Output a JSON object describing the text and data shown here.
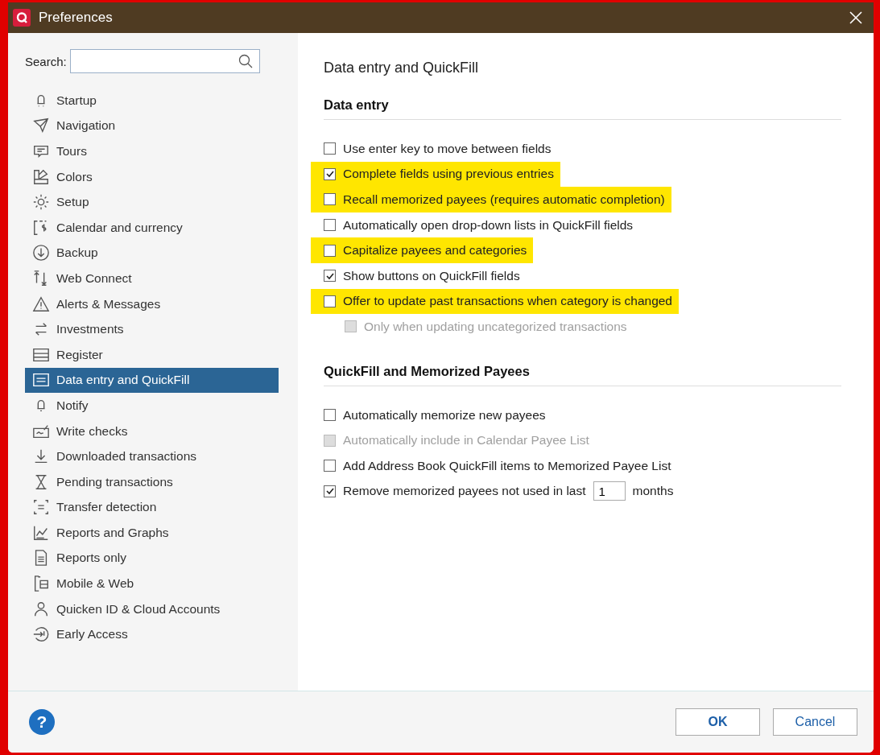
{
  "window": {
    "title": "Preferences"
  },
  "search": {
    "label": "Search:"
  },
  "sidebar": {
    "items": [
      {
        "label": "Startup",
        "selected": false
      },
      {
        "label": "Navigation",
        "selected": false
      },
      {
        "label": "Tours",
        "selected": false
      },
      {
        "label": "Colors",
        "selected": false
      },
      {
        "label": "Setup",
        "selected": false
      },
      {
        "label": "Calendar and currency",
        "selected": false
      },
      {
        "label": "Backup",
        "selected": false
      },
      {
        "label": "Web Connect",
        "selected": false
      },
      {
        "label": "Alerts & Messages",
        "selected": false
      },
      {
        "label": "Investments",
        "selected": false
      },
      {
        "label": "Register",
        "selected": false
      },
      {
        "label": "Data entry and QuickFill",
        "selected": true
      },
      {
        "label": "Notify",
        "selected": false
      },
      {
        "label": "Write checks",
        "selected": false
      },
      {
        "label": "Downloaded transactions",
        "selected": false
      },
      {
        "label": "Pending transactions",
        "selected": false
      },
      {
        "label": "Transfer detection",
        "selected": false
      },
      {
        "label": "Reports and Graphs",
        "selected": false
      },
      {
        "label": "Reports only",
        "selected": false
      },
      {
        "label": "Mobile & Web",
        "selected": false
      },
      {
        "label": "Quicken ID & Cloud Accounts",
        "selected": false
      },
      {
        "label": "Early Access",
        "selected": false
      }
    ]
  },
  "page_title": "Data entry and QuickFill",
  "sections": [
    {
      "heading": "Data entry",
      "options": [
        {
          "kind": "checkbox",
          "label": "Use enter key to move between fields",
          "checked": false,
          "disabled": false,
          "highlighted": false
        },
        {
          "kind": "checkbox",
          "label": "Complete fields using previous entries",
          "checked": true,
          "disabled": false,
          "highlighted": true
        },
        {
          "kind": "checkbox",
          "label": "Recall memorized payees (requires automatic completion)",
          "checked": false,
          "disabled": false,
          "highlighted": true
        },
        {
          "kind": "checkbox",
          "label": "Automatically open drop-down lists in QuickFill fields",
          "checked": false,
          "disabled": false,
          "highlighted": false
        },
        {
          "kind": "checkbox",
          "label": "Capitalize payees and categories",
          "checked": false,
          "disabled": false,
          "highlighted": true
        },
        {
          "kind": "checkbox",
          "label": "Show buttons on QuickFill fields",
          "checked": true,
          "disabled": false,
          "highlighted": false
        },
        {
          "kind": "checkbox",
          "label": "Offer to update past transactions when category is changed",
          "checked": false,
          "disabled": false,
          "highlighted": true,
          "children": [
            {
              "label": "Only when updating uncategorized transactions",
              "checked": false,
              "disabled": true
            }
          ]
        }
      ]
    },
    {
      "heading": "QuickFill and Memorized Payees",
      "options": [
        {
          "kind": "checkbox",
          "label": "Automatically memorize new payees",
          "checked": false,
          "disabled": false,
          "highlighted": false
        },
        {
          "kind": "checkbox",
          "label": "Automatically include in Calendar Payee List",
          "checked": false,
          "disabled": true,
          "highlighted": false
        },
        {
          "kind": "checkbox",
          "label": "Add Address Book QuickFill items to Memorized Payee List",
          "checked": false,
          "disabled": false,
          "highlighted": false
        },
        {
          "kind": "number",
          "label": "Remove memorized payees not used in last",
          "value": "1",
          "suffix": "months",
          "checked": true,
          "disabled": false,
          "highlighted": false
        }
      ]
    }
  ],
  "buttons": [
    {
      "label": "OK",
      "kind": "primary"
    },
    {
      "label": "Cancel",
      "kind": "secondary"
    }
  ],
  "help": {
    "label": "?"
  }
}
